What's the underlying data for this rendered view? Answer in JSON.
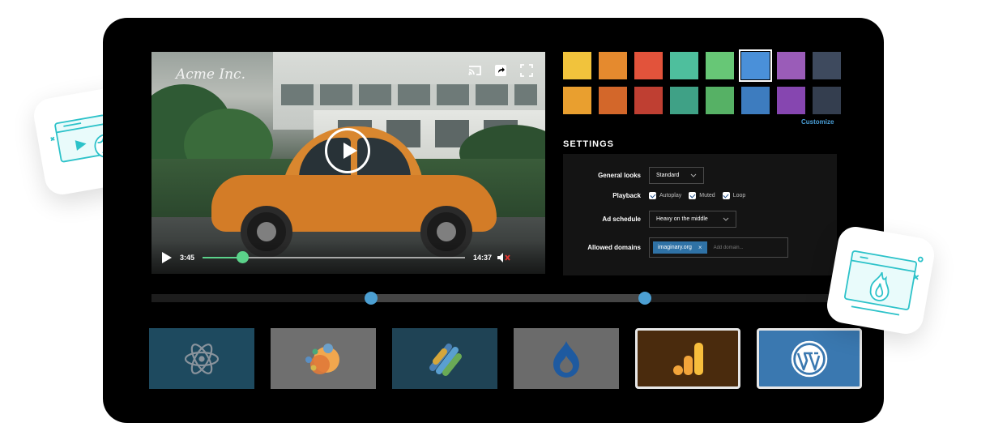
{
  "player": {
    "brand": "Acme Inc.",
    "current_time": "3:45",
    "duration": "14:37",
    "progress": 0.15,
    "icons": [
      "cast-icon",
      "share-icon",
      "fullscreen-icon",
      "play-icon",
      "volume-muted-icon"
    ]
  },
  "swatches": {
    "row1": [
      "#f1c33c",
      "#e58a2e",
      "#e2533b",
      "#4ebf9d",
      "#67c776",
      "#4a90d9",
      "#9a5cb8",
      "#3e4a5e"
    ],
    "row2": [
      "#e99f2f",
      "#d3672a",
      "#bf3f32",
      "#3fa186",
      "#56b165",
      "#3d7cbf",
      "#8646b0",
      "#343e4f"
    ],
    "selected_index": 5,
    "customize_label": "Customize"
  },
  "settings": {
    "title": "SETTINGS",
    "general_looks": {
      "label": "General looks",
      "value": "Standard"
    },
    "playback": {
      "label": "Playback",
      "options": [
        "Autoplay",
        "Muted",
        "Loop"
      ]
    },
    "ad_schedule": {
      "label": "Ad schedule",
      "value": "Heavy on the middle"
    },
    "allowed_domains": {
      "label": "Allowed domains",
      "tag": "imaginary.org",
      "placeholder": "Add domain..."
    }
  },
  "range": {
    "start": 0.32,
    "end": 0.72,
    "color": "#4c9fd2"
  },
  "integrations": [
    {
      "name": "react",
      "icon": "react-icon",
      "bg": "#1e4a5f",
      "selected": false
    },
    {
      "name": "google-marketing",
      "icon": "google-marketing-icon",
      "bg": "#6f6f6f",
      "selected": false
    },
    {
      "name": "google-tag-manager",
      "icon": "google-tag-manager-icon",
      "bg": "#1f4355",
      "selected": false
    },
    {
      "name": "drupal",
      "icon": "drupal-icon",
      "bg": "#6b6b6b",
      "selected": false
    },
    {
      "name": "google-analytics",
      "icon": "google-analytics-icon",
      "bg": "#4a2b0d",
      "selected": true
    },
    {
      "name": "wordpress",
      "icon": "wordpress-icon",
      "bg": "#3a78b0",
      "selected": true
    }
  ],
  "floating_cards": [
    "browser-globe-icon",
    "browser-flame-icon"
  ]
}
